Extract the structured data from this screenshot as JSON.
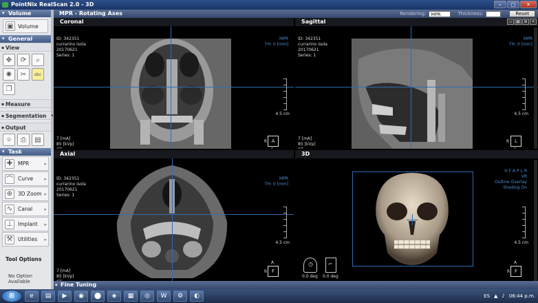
{
  "window": {
    "title": "PointNix RealScan 2.0 - 3D",
    "minimize": "–",
    "maximize": "□",
    "close": "✕"
  },
  "sidebar": {
    "volume": {
      "header": "Volume",
      "button": "Volume",
      "icon": "volume-icon"
    },
    "general": {
      "header": "General",
      "view_label": "View",
      "tools": [
        "pan-icon",
        "rotate-icon",
        "zoom-magnifier-icon",
        "brightness-icon",
        "cut-icon",
        "abc-annotation-icon",
        "copy-icon"
      ],
      "abc": "abc",
      "measure_label": "Measure",
      "segmentation_label": "Segmentation",
      "output_label": "Output",
      "output_tools": [
        "camera-icon",
        "printer-icon",
        "save-icon"
      ]
    },
    "task": {
      "header": "Task",
      "items": [
        {
          "label": "MPR",
          "icon": "mpr-icon"
        },
        {
          "label": "Curve",
          "icon": "curve-icon"
        },
        {
          "label": "3D Zoom",
          "icon": "3d-zoom-icon"
        },
        {
          "label": "Canal",
          "icon": "canal-icon"
        },
        {
          "label": "Implant",
          "icon": "implant-icon"
        },
        {
          "label": "Utilities",
          "icon": "utilities-icon"
        }
      ]
    },
    "tool_options": {
      "title": "Tool Options",
      "value": "No Option Available"
    }
  },
  "main": {
    "title": "MPR - Rotating Axes",
    "rendering_label": "Rendering:",
    "rendering_value": "MPR",
    "thickness_label": "Thickness:",
    "thickness_value": "",
    "reset_label": "Reset"
  },
  "patient": {
    "id": "ID: 342351",
    "name": "currarino isola",
    "date": "20170621",
    "series": "Series: 1"
  },
  "acq": {
    "ma": "7 [mA]",
    "kvp": "85 [kVp]",
    "modality": "CT"
  },
  "mpr_info": {
    "mode": "MPR",
    "th": "TH: 0 [mm]",
    "scale": "4.5 cm"
  },
  "panes": {
    "coronal": {
      "title": "Coronal",
      "orient_left": "R",
      "orient_box": "A",
      "orient_bottom": "F"
    },
    "sagittal": {
      "title": "Sagittal",
      "orient_left": "R",
      "orient_box": "L",
      "orient_bottom": "F"
    },
    "axial": {
      "title": "Axial",
      "orient_top": "A",
      "orient_left": "R",
      "orient_box": "F"
    },
    "threed": {
      "title": "3D",
      "orient_keys": "H F A P L R",
      "mode": "VR",
      "overlay": "Outline Overlay",
      "shading": "Shading On",
      "angle1": "0.0 deg",
      "angle2": "0.0 deg",
      "orient_top": "A",
      "orient_left": "R",
      "orient_box": "F"
    }
  },
  "fine_tuning": "Fine Tuning",
  "taskbar": {
    "start": "⊞",
    "items": [
      "e",
      "▤",
      "▶",
      "◉",
      "⬤",
      "◈",
      "▦",
      "◎",
      "W",
      "⚙",
      "◐"
    ],
    "lang": "ES",
    "clock": "06:44 p.m."
  }
}
